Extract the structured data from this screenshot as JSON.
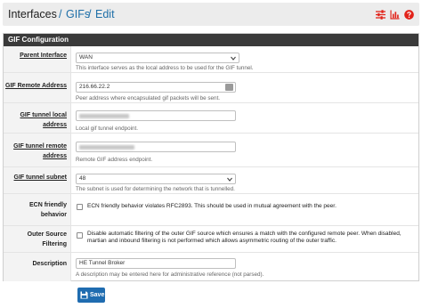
{
  "breadcrumb": {
    "root": "Interfaces",
    "sep1": "/",
    "section": "GIFs",
    "sep2": "/",
    "current": "Edit"
  },
  "toolbar": {
    "icons": [
      "sliders-icon",
      "bar-chart-icon",
      "help-icon"
    ],
    "accent_color": "#e2231a"
  },
  "panel": {
    "title": "GIF Configuration"
  },
  "form": {
    "parent_interface": {
      "label": "Parent Interface",
      "value": "WAN",
      "hint": "This interface serves as the local address to be used for the GIF tunnel."
    },
    "remote_address": {
      "label": "GIF Remote Address",
      "value": "216.66.22.2",
      "hint": "Peer address where encapsulated gif packets will be sent."
    },
    "tunnel_local": {
      "label": "GIF tunnel local address",
      "hint": "Local gif tunnel endpoint."
    },
    "tunnel_remote": {
      "label": "GIF tunnel remote address",
      "hint": "Remote GIF address endpoint."
    },
    "tunnel_subnet": {
      "label": "GIF tunnel subnet",
      "value": "48",
      "hint": "The subnet is used for determining the network that is tunnelled."
    },
    "ecn": {
      "label": "ECN friendly behavior",
      "checkbox_text": "ECN friendly behavior violates RFC2893. This should be used in mutual agreement with the peer.",
      "checked": false
    },
    "outer_filter": {
      "label": "Outer Source Filtering",
      "checkbox_text": "Disable automatic filtering of the outer GIF source which ensures a match with the configured remote peer. When disabled, martian and inbound filtering is not performed which allows asymmetric routing of the outer traffic.",
      "checked": false
    },
    "description": {
      "label": "Description",
      "value": "HE Tunnel Broker",
      "hint": "A description may be entered here for administrative reference (not parsed)."
    }
  },
  "save_button": {
    "label": "Save",
    "color": "#1f6cb0"
  }
}
